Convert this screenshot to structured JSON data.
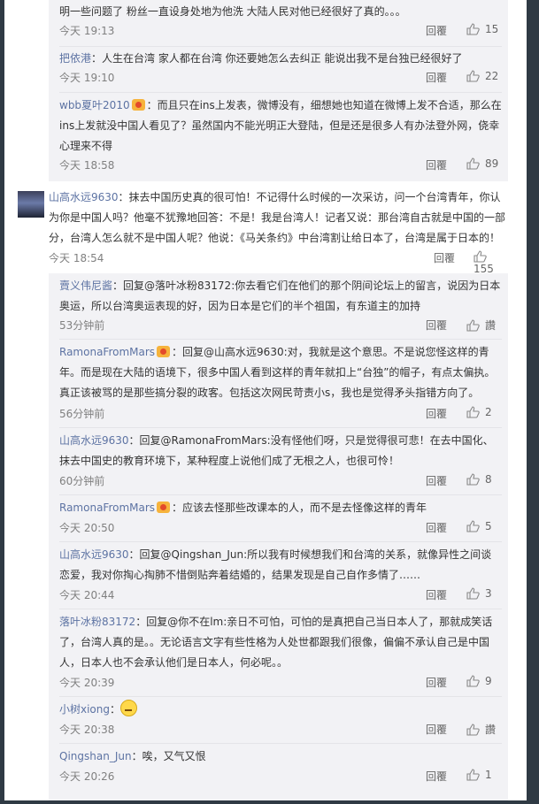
{
  "ui": {
    "reply": "回覆",
    "like_icon": "thumbs-up-icon"
  },
  "comments": [
    {
      "user": "",
      "text": "明一些问题了 粉丝一直设身处地为他洗 大陆人民对他已经很好了真的。。。",
      "time": "今天 19:13",
      "likes": "15"
    },
    {
      "user": "把依港",
      "text": "：人生在台湾 家人都在台湾 你还要她怎么去纠正 能说出我不是台独已经很好了",
      "time": "今天 19:10",
      "likes": "22"
    },
    {
      "user": "wbb夏叶2010",
      "text": "：而且只在ins上发表，微博没有，细想她也知道在微博上发不合适，那么在ins上发就没中国人看见了？虽然国内不能光明正大登陆，但是还是很多人有办法登外网，侥幸心理来不得",
      "time": "今天 18:58",
      "likes": "89"
    },
    {
      "user": "山高水远9630",
      "text": "：抹去中国历史真的很可怕！不记得什么时候的一次采访，问一个台湾青年，你认为你是中国人吗？他毫不犹豫地回答：不是！我是台湾人！记者又说：那台湾自古就是中国的一部分，台湾人怎么就不是中国人呢？他说：《马关条约》中台湾割让给日本了，台湾是属于日本的！",
      "time": "今天 18:54",
      "likes": "155"
    },
    {
      "user": "賣义伟尼酱",
      "text": "：回复@落叶冰粉83172:你去看它们在他们的那个阴间论坛上的留言，说因为日本奥运，所以台湾奥运表现的好，因为日本是它们的半个祖国，有东道主的加持",
      "time": "53分钟前",
      "likes": "讚"
    },
    {
      "user": "RamonaFromMars",
      "text": "：回复@山高水远9630:对，我就是这个意思。不是说您怪这样的青年。而是现在大陆的语境下，很多中国人看到这样的青年就扣上“台独”的帽子，有点太偏执。真正该被骂的是那些搞分裂的政客。包括这次网民苛责小s，我也是觉得矛头指错方向了。",
      "time": "56分钟前",
      "likes": "2"
    },
    {
      "user": "山高水远9630",
      "text": "：回复@RamonaFromMars:没有怪他们呀，只是觉得很可悲！在去中国化、抹去中国史的教育环境下，某种程度上说他们成了无根之人，也很可怜！",
      "time": "60分钟前",
      "likes": "8"
    },
    {
      "user": "RamonaFromMars",
      "text": "：应该去怪那些改课本的人，而不是去怪像这样的青年",
      "time": "今天 20:50",
      "likes": "5"
    },
    {
      "user": "山高水远9630",
      "text": "：回复@Qingshan_Jun:所以我有时候想我们和台湾的关系，就像异性之间谈恋爱，我对你掏心掏肺不惜倒贴奔着结婚的，结果发现是自己自作多情了……",
      "time": "今天 20:44",
      "likes": "3"
    },
    {
      "user": "落叶冰粉83172",
      "text": "：回复@你不在lm:亲日不可怕，可怕的是真把自己当日本人了，那就成笑话了，台湾人真的是。。无论语言文字有些性格为人处世都跟我们很像，偏偏不承认自己是中国人，日本人也不会承认他们是日本人，何必呢。。",
      "time": "今天 20:39",
      "likes": "9"
    },
    {
      "user": "小树xiong",
      "text": "：",
      "time": "今天 20:38",
      "likes": "讚"
    },
    {
      "user": "Qingshan_Jun",
      "text": "：唉，又气又恨",
      "time": "今天 20:26",
      "likes": "1"
    }
  ]
}
